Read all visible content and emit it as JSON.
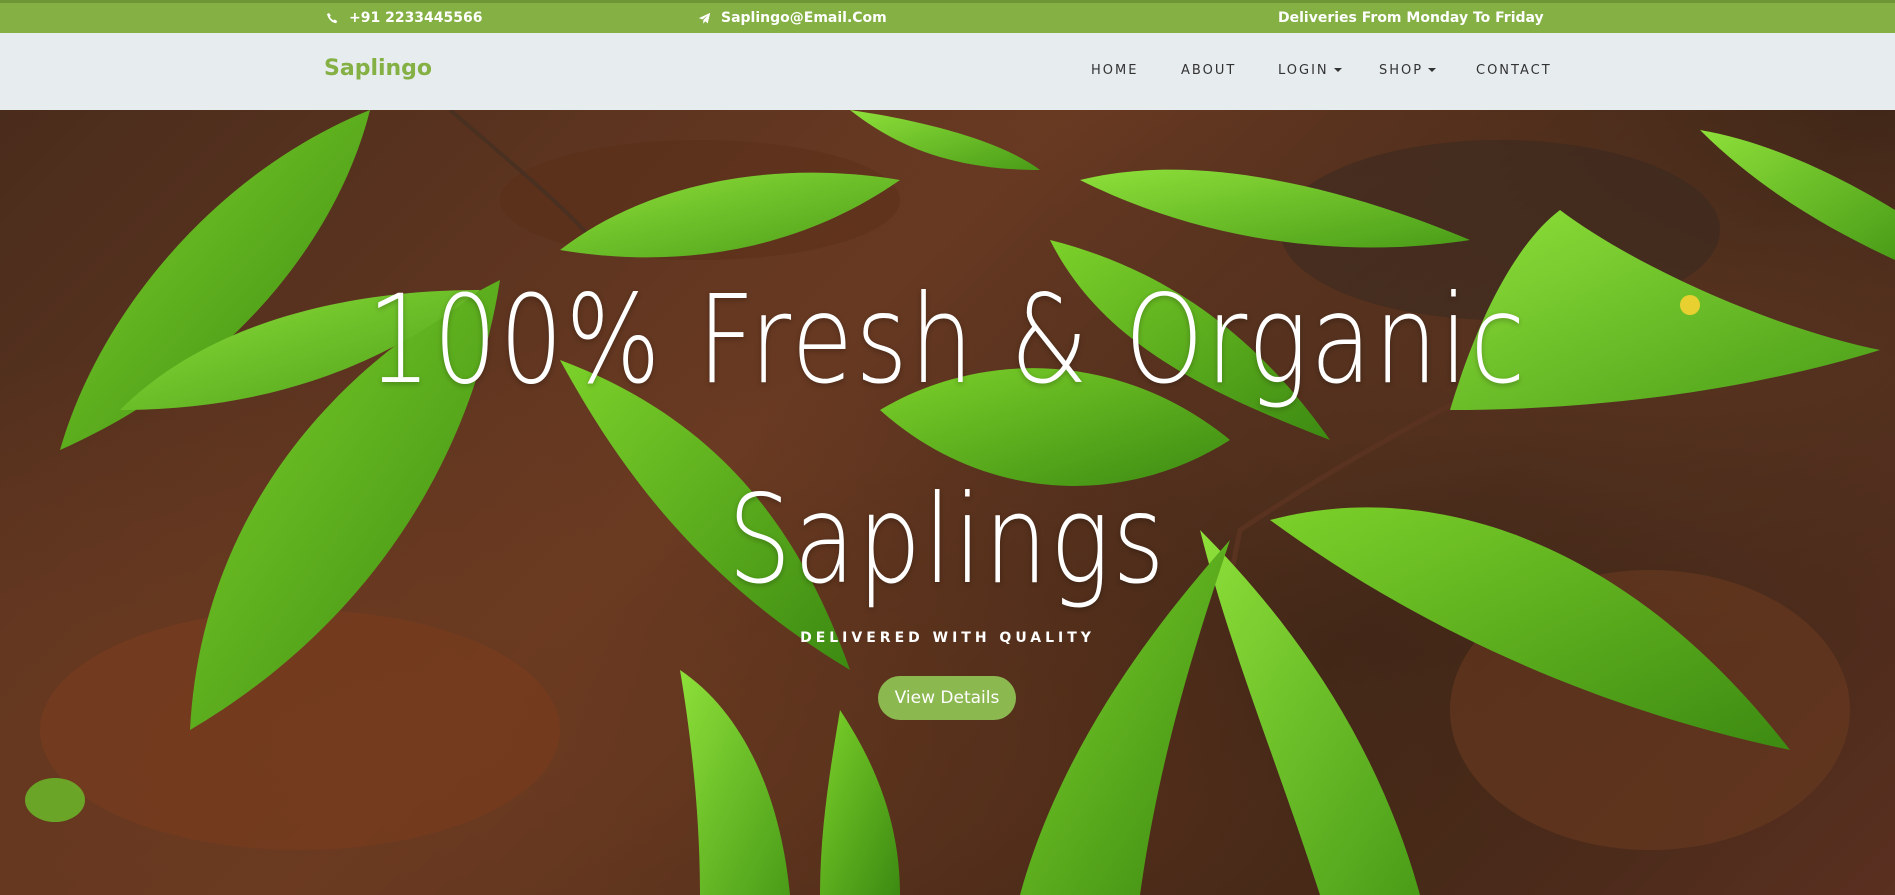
{
  "topbar": {
    "phone": "+91 2233445566",
    "email": "Saplingo@Email.Com",
    "delivery": "Deliveries From Monday To Friday",
    "color": "#84b044"
  },
  "navbar": {
    "brand": "Saplingo",
    "items": [
      {
        "label": "HOME",
        "dropdown": false
      },
      {
        "label": "ABOUT",
        "dropdown": false
      },
      {
        "label": "LOGIN",
        "dropdown": true
      },
      {
        "label": "SHOP",
        "dropdown": true
      },
      {
        "label": "CONTACT",
        "dropdown": false
      }
    ]
  },
  "hero": {
    "title_line1": "100% Fresh & Organic",
    "title_line2": "Saplings",
    "subtitle": "DELIVERED WITH QUALITY",
    "button": "View Details"
  }
}
